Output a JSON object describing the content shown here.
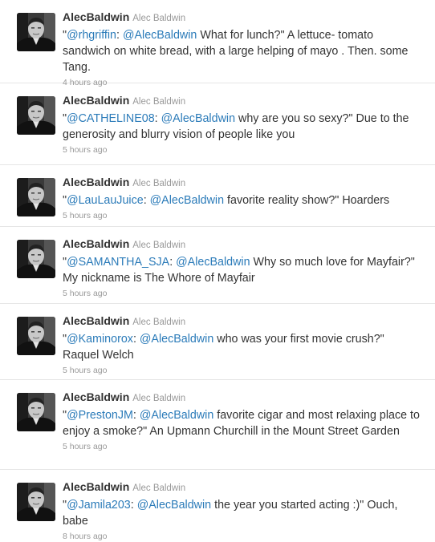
{
  "tweets": [
    {
      "author_name": "AlecBaldwin",
      "author_handle": "Alec Baldwin",
      "parts": [
        {
          "t": "\"",
          "m": false
        },
        {
          "t": "@rhgriffin",
          "m": true
        },
        {
          "t": ": ",
          "m": false
        },
        {
          "t": "@AlecBaldwin",
          "m": true
        },
        {
          "t": " What for lunch?\" A lettuce- tomato sandwich on white bread, with a large helping of mayo . Then. some Tang.",
          "m": false
        }
      ],
      "time": "4 hours ago"
    },
    {
      "author_name": "AlecBaldwin",
      "author_handle": "Alec Baldwin",
      "parts": [
        {
          "t": "\"",
          "m": false
        },
        {
          "t": "@CATHELINE08",
          "m": true
        },
        {
          "t": ": ",
          "m": false
        },
        {
          "t": "@AlecBaldwin",
          "m": true
        },
        {
          "t": " why are you so sexy?\" Due to the generosity and blurry vision of people like you",
          "m": false
        }
      ],
      "time": "5 hours ago"
    },
    {
      "author_name": "AlecBaldwin",
      "author_handle": "Alec Baldwin",
      "parts": [
        {
          "t": "\"",
          "m": false
        },
        {
          "t": "@LauLauJuice",
          "m": true
        },
        {
          "t": ": ",
          "m": false
        },
        {
          "t": "@AlecBaldwin",
          "m": true
        },
        {
          "t": " favorite reality show?\" Hoarders",
          "m": false
        }
      ],
      "time": "5 hours ago"
    },
    {
      "author_name": "AlecBaldwin",
      "author_handle": "Alec Baldwin",
      "parts": [
        {
          "t": "\"",
          "m": false
        },
        {
          "t": "@SAMANTHA_SJA",
          "m": true
        },
        {
          "t": ": ",
          "m": false
        },
        {
          "t": "@AlecBaldwin",
          "m": true
        },
        {
          "t": " Why so much love for Mayfair?\" My nickname is The Whore of Mayfair",
          "m": false
        }
      ],
      "time": "5 hours ago"
    },
    {
      "author_name": "AlecBaldwin",
      "author_handle": "Alec Baldwin",
      "parts": [
        {
          "t": "\"",
          "m": false
        },
        {
          "t": "@Kaminorox",
          "m": true
        },
        {
          "t": ": ",
          "m": false
        },
        {
          "t": "@AlecBaldwin",
          "m": true
        },
        {
          "t": " who was your first movie crush?\" Raquel Welch",
          "m": false
        }
      ],
      "time": "5 hours ago"
    },
    {
      "author_name": "AlecBaldwin",
      "author_handle": "Alec Baldwin",
      "parts": [
        {
          "t": "\"",
          "m": false
        },
        {
          "t": "@PrestonJM",
          "m": true
        },
        {
          "t": ": ",
          "m": false
        },
        {
          "t": "@AlecBaldwin",
          "m": true
        },
        {
          "t": " favorite cigar and most relaxing place to enjoy a smoke?\" An Upmann Churchill in the Mount Street Garden",
          "m": false
        }
      ],
      "time": "5 hours ago"
    },
    {
      "author_name": "AlecBaldwin",
      "author_handle": "Alec Baldwin",
      "parts": [
        {
          "t": "\"",
          "m": false
        },
        {
          "t": "@Jamila203",
          "m": true
        },
        {
          "t": ": ",
          "m": false
        },
        {
          "t": "@AlecBaldwin",
          "m": true
        },
        {
          "t": " the year you started acting :)\" Ouch, babe",
          "m": false
        }
      ],
      "time": "8 hours ago"
    }
  ],
  "colors": {
    "text": "#333333",
    "link": "#2b7bb9",
    "muted": "#999999",
    "divider": "#e6e6e6"
  },
  "icons": {
    "avatar": "avatar-icon"
  }
}
